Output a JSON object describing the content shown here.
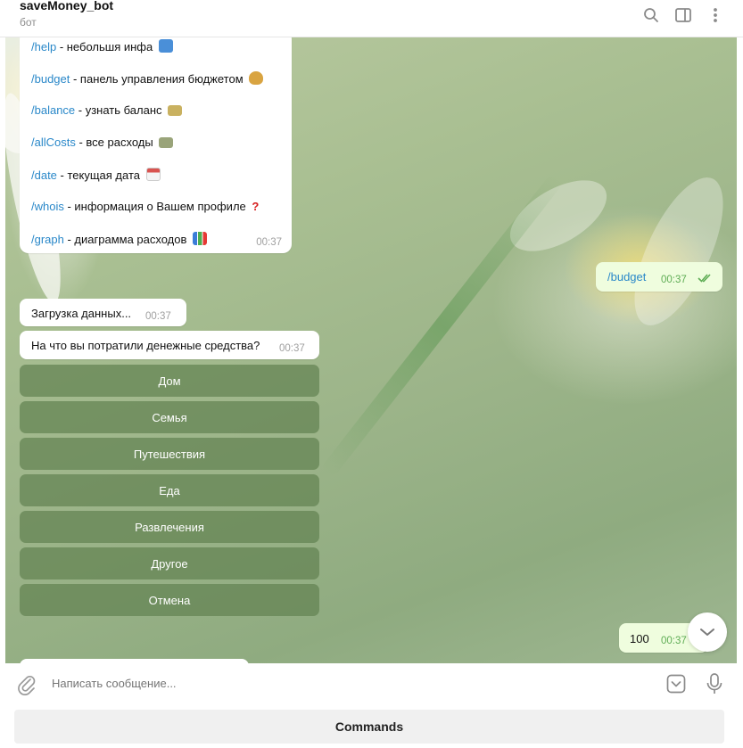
{
  "header": {
    "title": "saveMoney_bot",
    "subtitle": "бот",
    "icons": [
      "search-icon",
      "sidebar-icon",
      "more-icon"
    ]
  },
  "messages": {
    "commands": {
      "items": [
        {
          "cmd": "/help",
          "desc": " - небольшя инфа",
          "emoji": "info-emoji",
          "color": "#4a8fd8"
        },
        {
          "cmd": "/budget",
          "desc": " - панель управления бюджетом",
          "emoji": "money-bag-emoji",
          "color": "#d9a441"
        },
        {
          "cmd": "/balance",
          "desc": "  - узнать баланс",
          "emoji": "banknote-emoji",
          "color": "#c9b160"
        },
        {
          "cmd": "/allCosts",
          "desc": "  - все расходы",
          "emoji": "banknotes-emoji",
          "color": "#9aa47a"
        },
        {
          "cmd": "/date",
          "desc": " - текущая дата",
          "emoji": "calendar-emoji",
          "color": "#d9534f"
        },
        {
          "cmd": "/whois",
          "desc": " - информация о Вашем профиле",
          "emoji": "question-emoji",
          "color": "#d62020"
        },
        {
          "cmd": "/graph",
          "desc": " - диаграмма расходов",
          "emoji": "chart-emoji",
          "color": "#3b7dd8"
        }
      ],
      "time": "00:37"
    },
    "outgoing_budget": {
      "text": "/budget",
      "time": "00:37"
    },
    "loading": {
      "text": "Загрузка данных...",
      "time": "00:37"
    },
    "question": {
      "text": "На что вы потратили денежные средства?",
      "time": "00:37"
    },
    "keyboard": [
      "Дом",
      "Семья",
      "Путешествия",
      "Еда",
      "Развлечения",
      "Другое",
      "Отмена"
    ],
    "outgoing_amount": {
      "text": "100",
      "time": "00:37"
    }
  },
  "composer": {
    "placeholder": "Написать сообщение...",
    "commands_label": "Commands"
  },
  "colors": {
    "link": "#2a88c9",
    "outgoing_bubble": "#effdde",
    "keyboard_button": "#628252",
    "check": "#5fad55"
  }
}
